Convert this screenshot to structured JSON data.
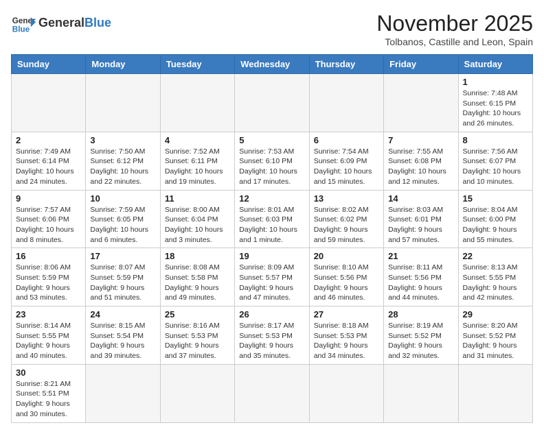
{
  "header": {
    "logo_general": "General",
    "logo_blue": "Blue",
    "month_title": "November 2025",
    "subtitle": "Tolbanos, Castille and Leon, Spain"
  },
  "weekdays": [
    "Sunday",
    "Monday",
    "Tuesday",
    "Wednesday",
    "Thursday",
    "Friday",
    "Saturday"
  ],
  "weeks": [
    [
      {
        "day": "",
        "info": ""
      },
      {
        "day": "",
        "info": ""
      },
      {
        "day": "",
        "info": ""
      },
      {
        "day": "",
        "info": ""
      },
      {
        "day": "",
        "info": ""
      },
      {
        "day": "",
        "info": ""
      },
      {
        "day": "1",
        "info": "Sunrise: 7:48 AM\nSunset: 6:15 PM\nDaylight: 10 hours and 26 minutes."
      }
    ],
    [
      {
        "day": "2",
        "info": "Sunrise: 7:49 AM\nSunset: 6:14 PM\nDaylight: 10 hours and 24 minutes."
      },
      {
        "day": "3",
        "info": "Sunrise: 7:50 AM\nSunset: 6:12 PM\nDaylight: 10 hours and 22 minutes."
      },
      {
        "day": "4",
        "info": "Sunrise: 7:52 AM\nSunset: 6:11 PM\nDaylight: 10 hours and 19 minutes."
      },
      {
        "day": "5",
        "info": "Sunrise: 7:53 AM\nSunset: 6:10 PM\nDaylight: 10 hours and 17 minutes."
      },
      {
        "day": "6",
        "info": "Sunrise: 7:54 AM\nSunset: 6:09 PM\nDaylight: 10 hours and 15 minutes."
      },
      {
        "day": "7",
        "info": "Sunrise: 7:55 AM\nSunset: 6:08 PM\nDaylight: 10 hours and 12 minutes."
      },
      {
        "day": "8",
        "info": "Sunrise: 7:56 AM\nSunset: 6:07 PM\nDaylight: 10 hours and 10 minutes."
      }
    ],
    [
      {
        "day": "9",
        "info": "Sunrise: 7:57 AM\nSunset: 6:06 PM\nDaylight: 10 hours and 8 minutes."
      },
      {
        "day": "10",
        "info": "Sunrise: 7:59 AM\nSunset: 6:05 PM\nDaylight: 10 hours and 6 minutes."
      },
      {
        "day": "11",
        "info": "Sunrise: 8:00 AM\nSunset: 6:04 PM\nDaylight: 10 hours and 3 minutes."
      },
      {
        "day": "12",
        "info": "Sunrise: 8:01 AM\nSunset: 6:03 PM\nDaylight: 10 hours and 1 minute."
      },
      {
        "day": "13",
        "info": "Sunrise: 8:02 AM\nSunset: 6:02 PM\nDaylight: 9 hours and 59 minutes."
      },
      {
        "day": "14",
        "info": "Sunrise: 8:03 AM\nSunset: 6:01 PM\nDaylight: 9 hours and 57 minutes."
      },
      {
        "day": "15",
        "info": "Sunrise: 8:04 AM\nSunset: 6:00 PM\nDaylight: 9 hours and 55 minutes."
      }
    ],
    [
      {
        "day": "16",
        "info": "Sunrise: 8:06 AM\nSunset: 5:59 PM\nDaylight: 9 hours and 53 minutes."
      },
      {
        "day": "17",
        "info": "Sunrise: 8:07 AM\nSunset: 5:59 PM\nDaylight: 9 hours and 51 minutes."
      },
      {
        "day": "18",
        "info": "Sunrise: 8:08 AM\nSunset: 5:58 PM\nDaylight: 9 hours and 49 minutes."
      },
      {
        "day": "19",
        "info": "Sunrise: 8:09 AM\nSunset: 5:57 PM\nDaylight: 9 hours and 47 minutes."
      },
      {
        "day": "20",
        "info": "Sunrise: 8:10 AM\nSunset: 5:56 PM\nDaylight: 9 hours and 46 minutes."
      },
      {
        "day": "21",
        "info": "Sunrise: 8:11 AM\nSunset: 5:56 PM\nDaylight: 9 hours and 44 minutes."
      },
      {
        "day": "22",
        "info": "Sunrise: 8:13 AM\nSunset: 5:55 PM\nDaylight: 9 hours and 42 minutes."
      }
    ],
    [
      {
        "day": "23",
        "info": "Sunrise: 8:14 AM\nSunset: 5:55 PM\nDaylight: 9 hours and 40 minutes."
      },
      {
        "day": "24",
        "info": "Sunrise: 8:15 AM\nSunset: 5:54 PM\nDaylight: 9 hours and 39 minutes."
      },
      {
        "day": "25",
        "info": "Sunrise: 8:16 AM\nSunset: 5:53 PM\nDaylight: 9 hours and 37 minutes."
      },
      {
        "day": "26",
        "info": "Sunrise: 8:17 AM\nSunset: 5:53 PM\nDaylight: 9 hours and 35 minutes."
      },
      {
        "day": "27",
        "info": "Sunrise: 8:18 AM\nSunset: 5:53 PM\nDaylight: 9 hours and 34 minutes."
      },
      {
        "day": "28",
        "info": "Sunrise: 8:19 AM\nSunset: 5:52 PM\nDaylight: 9 hours and 32 minutes."
      },
      {
        "day": "29",
        "info": "Sunrise: 8:20 AM\nSunset: 5:52 PM\nDaylight: 9 hours and 31 minutes."
      }
    ],
    [
      {
        "day": "30",
        "info": "Sunrise: 8:21 AM\nSunset: 5:51 PM\nDaylight: 9 hours and 30 minutes."
      },
      {
        "day": "",
        "info": ""
      },
      {
        "day": "",
        "info": ""
      },
      {
        "day": "",
        "info": ""
      },
      {
        "day": "",
        "info": ""
      },
      {
        "day": "",
        "info": ""
      },
      {
        "day": "",
        "info": ""
      }
    ]
  ]
}
